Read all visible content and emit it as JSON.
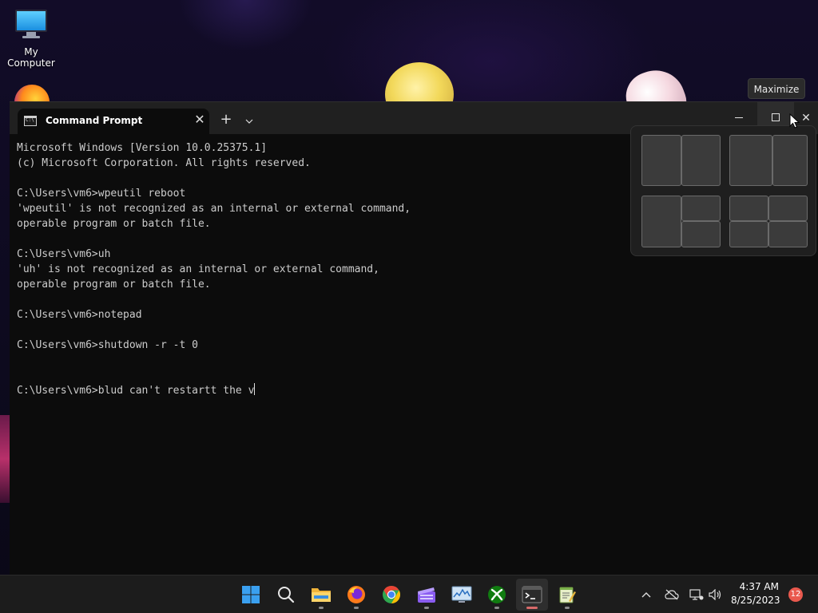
{
  "desktop": {
    "icons": [
      {
        "label": "My Computer"
      }
    ]
  },
  "tooltip": {
    "text": "Maximize"
  },
  "terminal": {
    "tab": {
      "title": "Command Prompt",
      "close_glyph": "✕"
    },
    "new_tab_glyph": "+",
    "dropdown_glyph": "⌄",
    "close_glyph": "✕",
    "lines": [
      "Microsoft Windows [Version 10.0.25375.1]",
      "(c) Microsoft Corporation. All rights reserved.",
      "",
      "C:\\Users\\vm6>wpeutil reboot",
      "'wpeutil' is not recognized as an internal or external command,",
      "operable program or batch file.",
      "",
      "C:\\Users\\vm6>uh",
      "'uh' is not recognized as an internal or external command,",
      "operable program or batch file.",
      "",
      "C:\\Users\\vm6>notepad",
      "",
      "C:\\Users\\vm6>shutdown -r -t 0",
      "",
      ""
    ],
    "input_line": "C:\\Users\\vm6>blud can't restartt the v"
  },
  "taskbar": {
    "apps": [
      {
        "name": "start-button",
        "icon": "windows-logo-icon",
        "pinned_active": false
      },
      {
        "name": "search-button",
        "icon": "search-icon",
        "pinned_active": false
      },
      {
        "name": "file-explorer-button",
        "icon": "folder-icon",
        "pinned_active": false
      },
      {
        "name": "firefox-button",
        "icon": "firefox-icon",
        "pinned_active": false
      },
      {
        "name": "chrome-button",
        "icon": "chrome-icon",
        "pinned_active": false
      },
      {
        "name": "clipchamp-button",
        "icon": "clipchamp-icon",
        "pinned_active": false
      },
      {
        "name": "resource-monitor-button",
        "icon": "monitor-chart-icon",
        "pinned_active": false
      },
      {
        "name": "xbox-button",
        "icon": "xbox-icon",
        "pinned_active": false
      },
      {
        "name": "terminal-button",
        "icon": "terminal-icon",
        "pinned_active": true
      },
      {
        "name": "notepad-button",
        "icon": "notepad-icon",
        "pinned_active": false
      }
    ],
    "tray": {
      "chevron": "^",
      "time": "4:37 AM",
      "date": "8/25/2023",
      "notification_count": "12"
    }
  },
  "colors": {
    "console_bg": "#0c0c0c",
    "console_fg": "#cccccc",
    "titlebar_bg": "#202020",
    "taskbar_bg": "#1c1c1c",
    "badge": "#e9594e"
  }
}
